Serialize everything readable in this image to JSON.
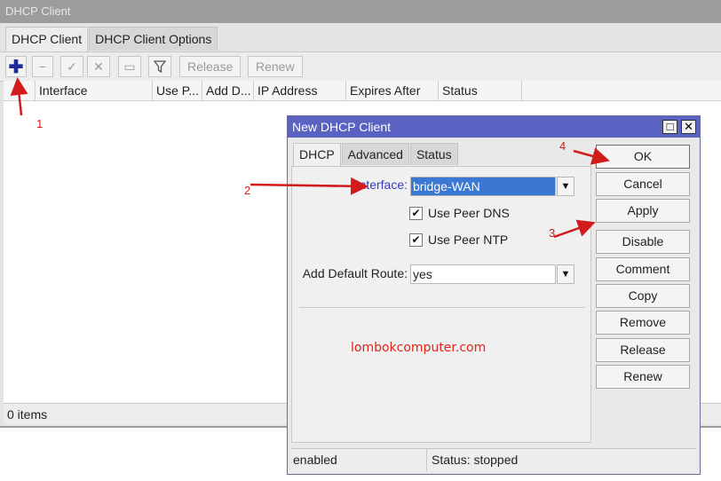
{
  "window": {
    "title": "DHCP Client",
    "tabs": [
      "DHCP Client",
      "DHCP Client Options"
    ],
    "toolbar": {
      "release_label": "Release",
      "renew_label": "Renew"
    },
    "table": {
      "columns": [
        "Interface",
        "Use P...",
        "Add D...",
        "IP Address",
        "Expires After",
        "Status"
      ]
    },
    "status_text": "0 items"
  },
  "dialog": {
    "title": "New DHCP Client",
    "tabs": [
      "DHCP",
      "Advanced",
      "Status"
    ],
    "interface_label": "Interface:",
    "interface_value": "bridge-WAN",
    "use_peer_dns_label": "Use Peer DNS",
    "use_peer_dns_checked": true,
    "use_peer_ntp_label": "Use Peer NTP",
    "use_peer_ntp_checked": true,
    "default_route_label": "Add Default Route:",
    "default_route_value": "yes",
    "watermark": "lombokcomputer.com",
    "buttons": [
      "OK",
      "Cancel",
      "Apply",
      "Disable",
      "Comment",
      "Copy",
      "Remove",
      "Release",
      "Renew"
    ],
    "status_enabled": "enabled",
    "status_text": "Status: stopped"
  },
  "annotations": [
    "1",
    "2",
    "3",
    "4"
  ],
  "colors": {
    "dialog_title_bg": "#5b63c2",
    "selection_bg": "#3a78d4",
    "annotation_red": "#d21c1c",
    "add_button_blue": "#1e2a9a"
  },
  "icons": [
    "plus-icon",
    "minus-icon",
    "check-icon",
    "cross-icon",
    "comment-icon",
    "filter-icon",
    "dropdown-arrow-icon",
    "checkbox-check-icon",
    "maximize-icon",
    "close-icon"
  ]
}
